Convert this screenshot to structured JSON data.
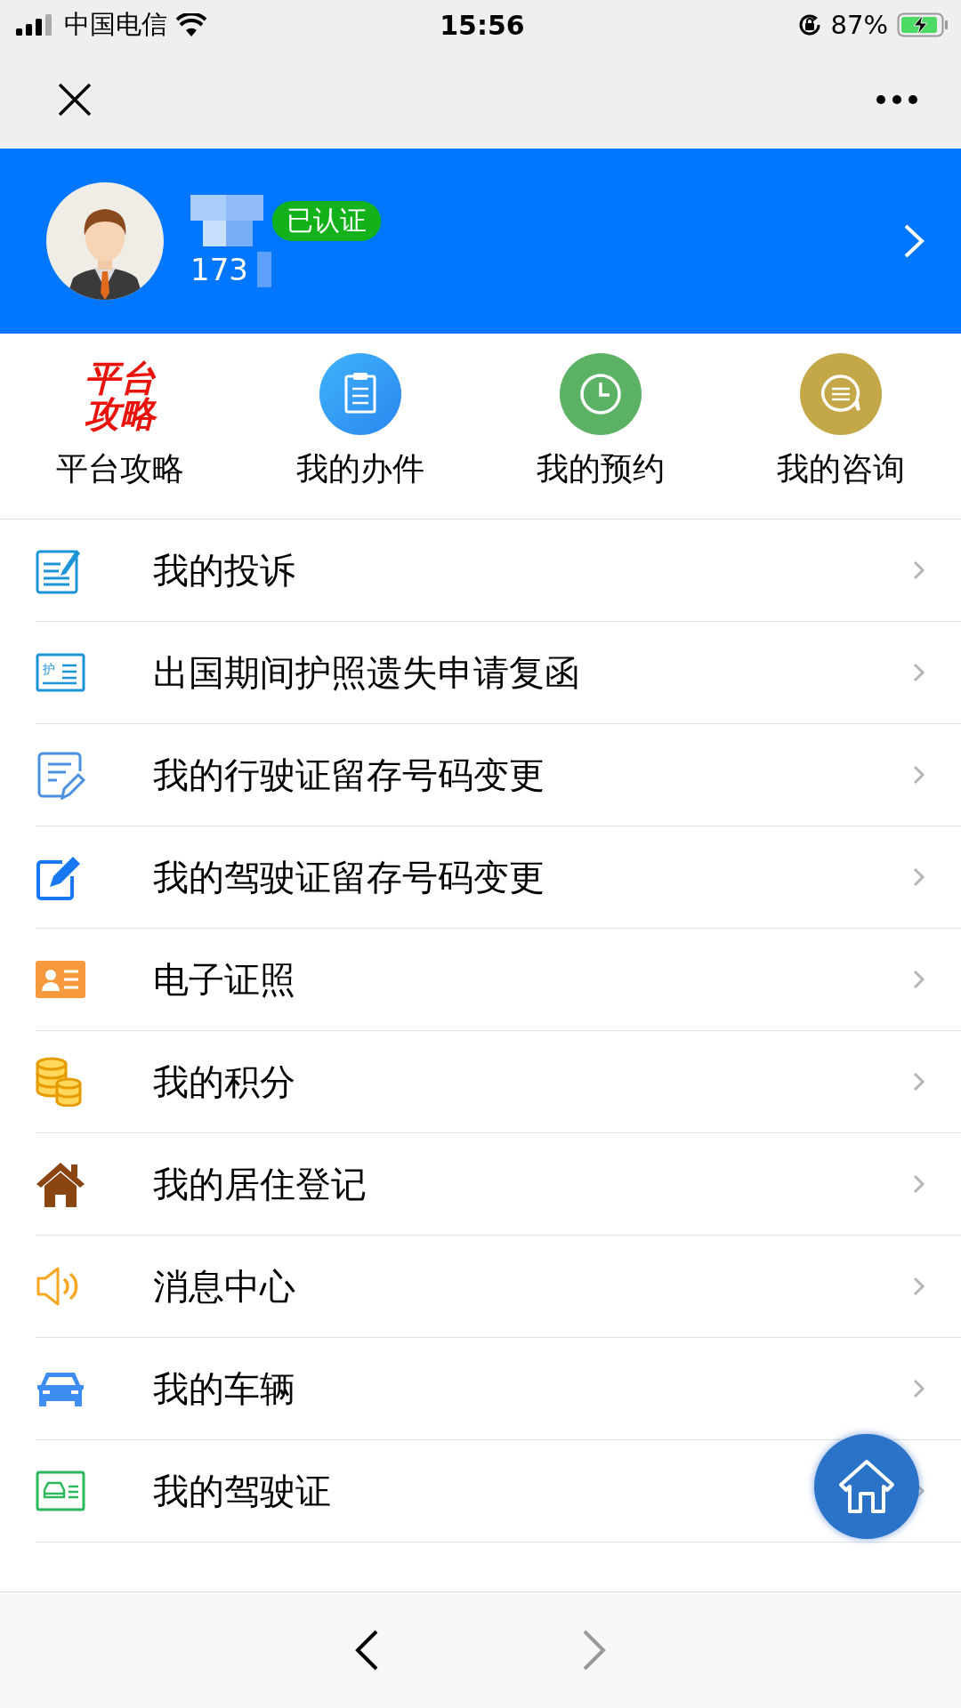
{
  "status_bar": {
    "carrier": "中国电信",
    "time": "15:56",
    "battery": "87%"
  },
  "profile": {
    "phone": "173",
    "badge": "已认证"
  },
  "quick_links": [
    {
      "kind": "logo",
      "logo_lines": [
        "平台",
        "攻略"
      ],
      "label": "平台攻略"
    },
    {
      "kind": "icon",
      "label": "我的办件"
    },
    {
      "kind": "icon",
      "label": "我的预约"
    },
    {
      "kind": "icon",
      "label": "我的咨询"
    }
  ],
  "menu": [
    {
      "label": "我的投诉"
    },
    {
      "label": "出国期间护照遗失申请复函",
      "icon_text": "护"
    },
    {
      "label": "我的行驶证留存号码变更"
    },
    {
      "label": "我的驾驶证留存号码变更"
    },
    {
      "label": "电子证照"
    },
    {
      "label": "我的积分"
    },
    {
      "label": "我的居住登记"
    },
    {
      "label": "消息中心"
    },
    {
      "label": "我的车辆"
    },
    {
      "label": "我的驾驶证"
    }
  ]
}
